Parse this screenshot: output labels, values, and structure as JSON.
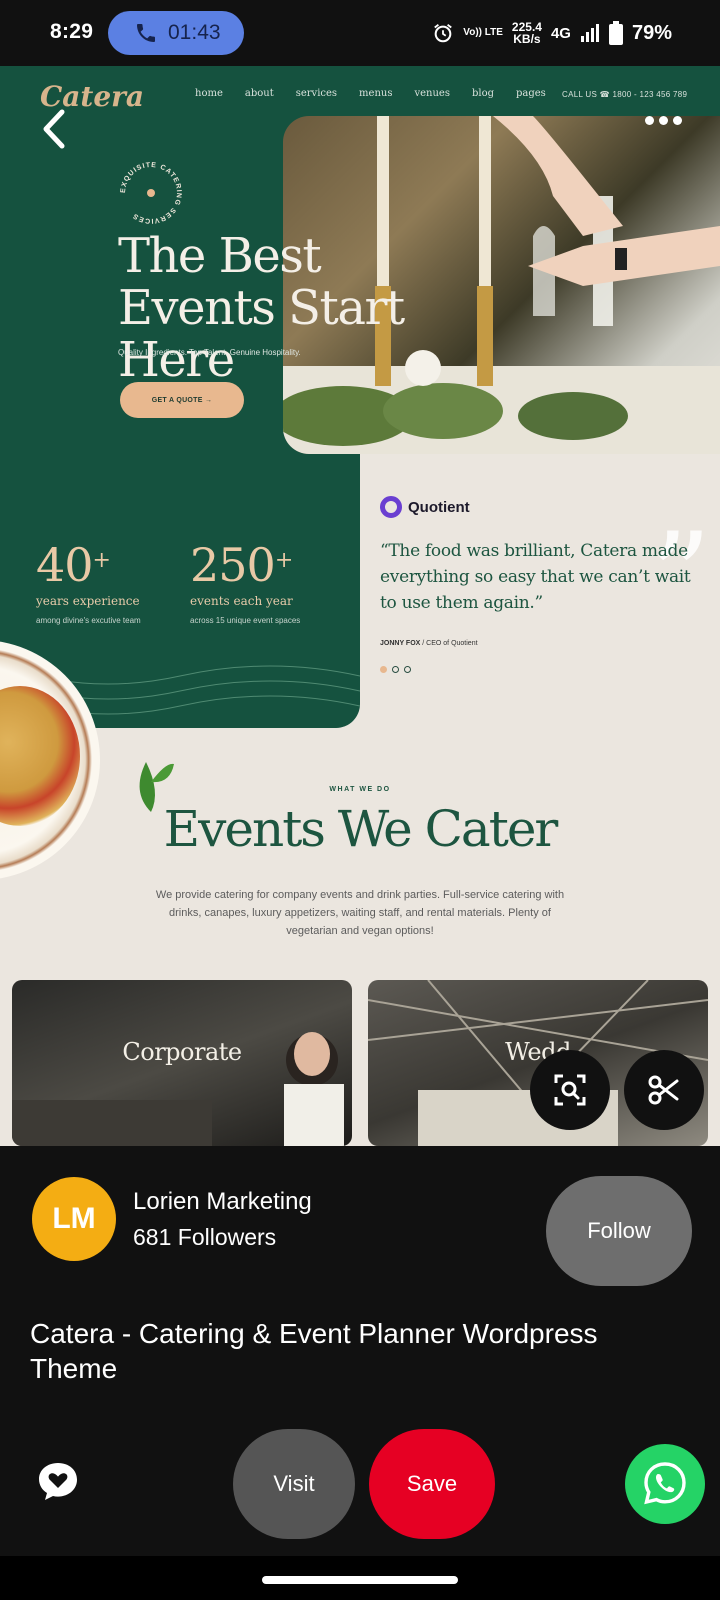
{
  "status_bar": {
    "time": "8:29",
    "call_timer": "01:43",
    "volte": "Vo)) LTE",
    "net_speed_value": "225.4",
    "net_speed_unit": "KB/s",
    "network": "4G",
    "battery": "79%",
    "icons": [
      "phone-icon",
      "alarm-icon",
      "signal-icon",
      "battery-icon"
    ]
  },
  "pin_image": {
    "logo": "Catera",
    "nav": [
      "home",
      "about",
      "services",
      "menus",
      "venues",
      "blog",
      "pages"
    ],
    "call_us": "CALL US ☎ 1800 - 123 456 789",
    "badge_text": "EXQUISITE CATERING SERVICES",
    "hero_title": "The Best Events Start Here",
    "hero_subtitle": "Quality Ingredients. Top Talent. Genuine Hospitality.",
    "quote_button": "GET A QUOTE →",
    "stats": [
      {
        "number": "40",
        "plus": "+",
        "label": "years experience",
        "sub": "among divine's excutive team"
      },
      {
        "number": "250",
        "plus": "+",
        "label": "events each year",
        "sub": "across 15 unique event spaces"
      }
    ],
    "testimonial": {
      "brand": "Quotient",
      "quote": "“The food was brilliant, Catera made everything so easy that we can’t wait to use them again.”",
      "author": "JONNY FOX",
      "role": "/ CEO of Quotient"
    },
    "section_kicker": "WHAT WE DO",
    "section_title": "Events We Cater",
    "section_desc": "We provide catering for company events and drink parties. Full-service catering with drinks, canapes, luxury appetizers, waiting staff, and rental materials. Plenty of vegetarian and vegan options!",
    "cards": [
      "Corporate",
      "Wedd"
    ]
  },
  "profile": {
    "initials": "LM",
    "name": "Lorien Marketing",
    "followers": "681 Followers",
    "follow_label": "Follow",
    "avatar_color": "#f4ad13"
  },
  "pin_title": "Catera - Catering & Event Planner Wordpress Theme",
  "actions": {
    "visit_label": "Visit",
    "save_label": "Save",
    "save_color": "#e60023",
    "whatsapp_color": "#25d366"
  }
}
